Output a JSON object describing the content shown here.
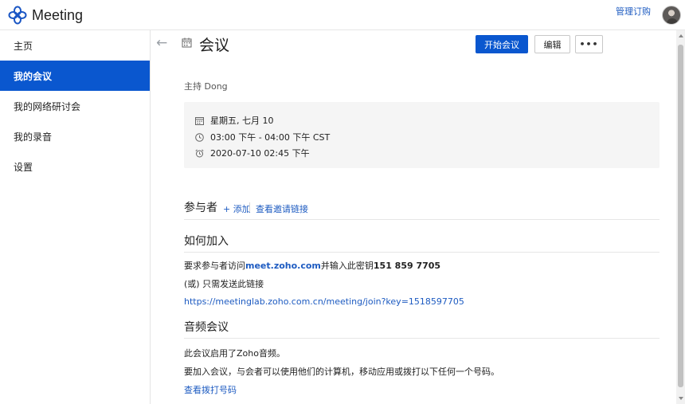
{
  "app": {
    "title": "Meeting"
  },
  "header": {
    "manage_link": "管理订购"
  },
  "sidebar": {
    "items": [
      {
        "label": "主页",
        "active": false
      },
      {
        "label": "我的会议",
        "active": true
      },
      {
        "label": "我的网络研讨会",
        "active": false
      },
      {
        "label": "我的录音",
        "active": false
      },
      {
        "label": "设置",
        "active": false
      }
    ]
  },
  "page": {
    "title": "会议",
    "buttons": {
      "start": "开始会议",
      "edit": "编辑",
      "more": "•••"
    },
    "host_label": "主持",
    "host_name": "Dong",
    "details": {
      "date": "星期五, 七月 10",
      "time": "03:00 下午 - 04:00 下午 CST",
      "reminder": "2020-07-10 02:45 下午"
    },
    "participants": {
      "title": "参与者",
      "add": "+ 添加",
      "invite_link": "查看邀请链接"
    },
    "how_to_join": {
      "title": "如何加入",
      "line1_prefix": "要求参与者访问",
      "line1_site": "meet.zoho.com",
      "line1_mid": "并输入此密钥",
      "line1_key": "151 859 7705",
      "line2": "(或) 只需发送此链接",
      "join_url": "https://meetinglab.zoho.com.cn/meeting/join?key=1518597705"
    },
    "audio": {
      "title": "音频会议",
      "line1": "此会议启用了Zoho音频。",
      "line2": "要加入会议，与会者可以使用他们的计算机，移动应用或拨打以下任何一个号码。",
      "dial_link": "查看拨打号码"
    }
  },
  "colors": {
    "accent": "#0a57cf",
    "link": "#1d5bc1"
  }
}
